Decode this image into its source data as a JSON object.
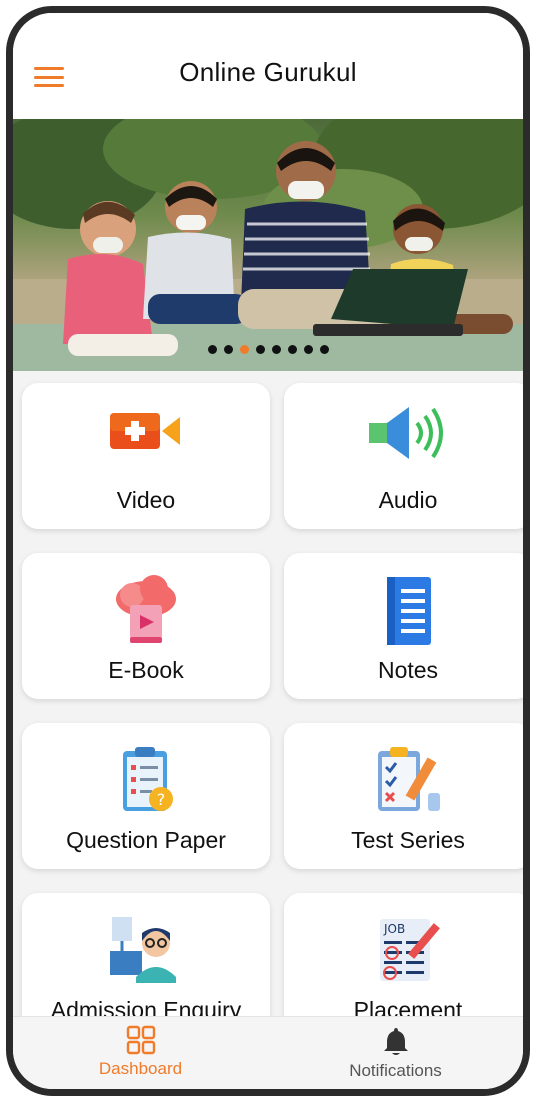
{
  "app": {
    "title": "Online Gurukul",
    "accent_color": "#f07b2a"
  },
  "banner": {
    "image": "children-with-teacher-and-laptop-photo",
    "slide_count": 8,
    "active_slide": 3
  },
  "tiles": [
    {
      "label": "Video",
      "icon": "video-add-icon"
    },
    {
      "label": "Audio",
      "icon": "speaker-icon"
    },
    {
      "label": "E-Book",
      "icon": "cloud-ebook-icon"
    },
    {
      "label": "Notes",
      "icon": "notebook-icon"
    },
    {
      "label": "Question Paper",
      "icon": "clipboard-question-icon"
    },
    {
      "label": "Test Series",
      "icon": "checklist-pencil-icon"
    },
    {
      "label": "Admission Enquiry",
      "icon": "counsellor-desk-icon"
    },
    {
      "label": "Placement",
      "icon": "job-listing-icon"
    }
  ],
  "bottom_nav": {
    "items": [
      {
        "label": "Dashboard",
        "icon": "dashboard-grid-icon",
        "active": true
      },
      {
        "label": "Notifications",
        "icon": "bell-icon",
        "active": false
      }
    ]
  }
}
